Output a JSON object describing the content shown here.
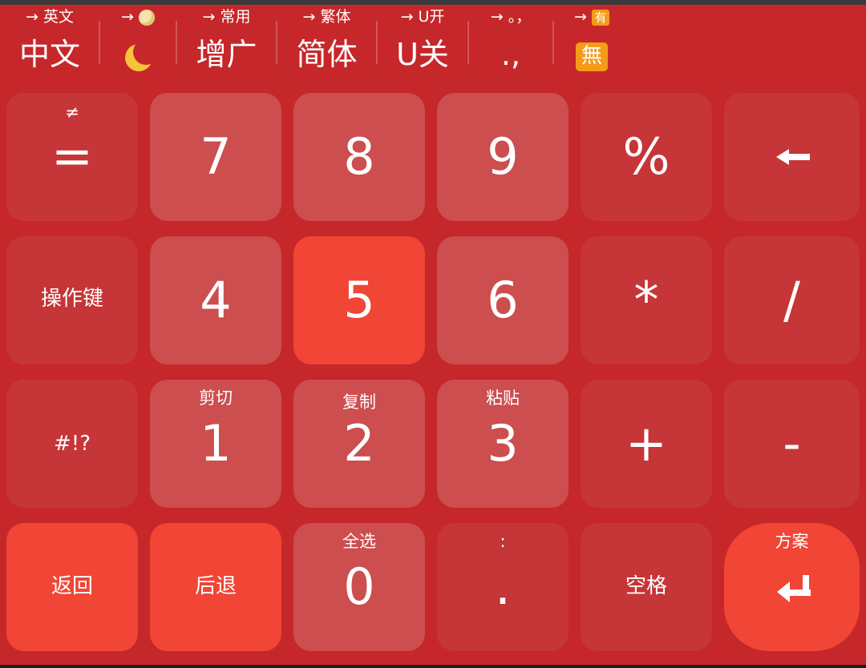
{
  "colors": {
    "background": "#c6272a",
    "function_key": "#c63537",
    "number_key": "#cc4e4f",
    "highlight_key": "#f14535",
    "text": "#ffffff"
  },
  "toolbar": {
    "items": [
      {
        "hint": "→ 英文",
        "label": "中文"
      },
      {
        "hint": "→",
        "label": "",
        "icon": "moon-icon",
        "hint_icon": "full-moon-icon"
      },
      {
        "hint": "→ 常用",
        "label": "增广"
      },
      {
        "hint": "→ 繁体",
        "label": "简体"
      },
      {
        "hint": "→ U开",
        "label": "U关"
      },
      {
        "hint": "→ 。，",
        "label": ".,"
      },
      {
        "hint": "→",
        "label": "🈚",
        "hint_badge": "有",
        "icon": "kanji-badge-icon"
      }
    ]
  },
  "keys": {
    "row1": [
      {
        "main": "=",
        "sup": "≠"
      },
      {
        "main": "7"
      },
      {
        "main": "8"
      },
      {
        "main": "9"
      },
      {
        "main": "%"
      },
      {
        "main": "",
        "icon": "backspace-arrow-icon"
      }
    ],
    "row2": [
      {
        "main": "操作键"
      },
      {
        "main": "4"
      },
      {
        "main": "5"
      },
      {
        "main": "6"
      },
      {
        "main": "*"
      },
      {
        "main": "/"
      }
    ],
    "row3": [
      {
        "main": "#!?"
      },
      {
        "main": "1",
        "sup": "剪切"
      },
      {
        "main": "2",
        "sup": "复制"
      },
      {
        "main": "3",
        "sup": "粘贴"
      },
      {
        "main": "+"
      },
      {
        "main": "-"
      }
    ],
    "row4": [
      {
        "main": "返回"
      },
      {
        "main": "后退"
      },
      {
        "main": "0",
        "sup": "全选"
      },
      {
        "main": ".",
        "sup": ":"
      },
      {
        "main": "空格"
      },
      {
        "main": "",
        "sup": "方案",
        "icon": "enter-icon"
      }
    ]
  }
}
